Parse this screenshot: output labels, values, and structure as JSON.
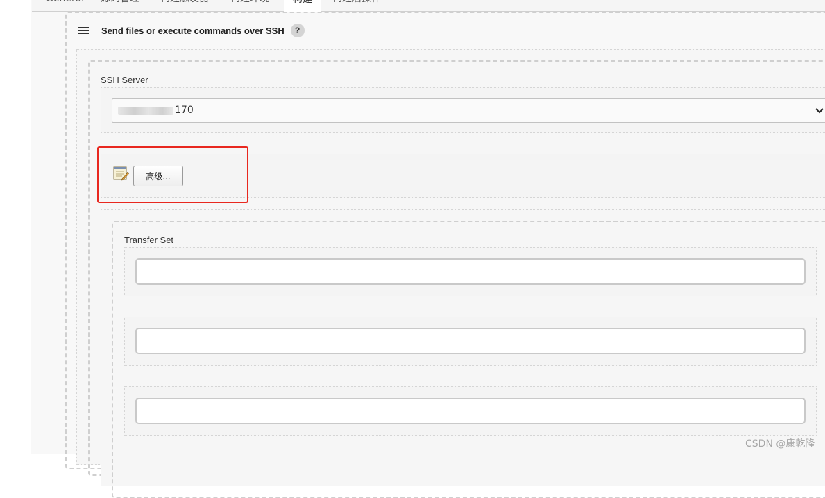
{
  "tabs": [
    {
      "label": "General",
      "active": false
    },
    {
      "label": "源码管理",
      "active": false
    },
    {
      "label": "构建触发器",
      "active": false
    },
    {
      "label": "构建环境",
      "active": false
    },
    {
      "label": "构建",
      "active": true
    },
    {
      "label": "构建后操作",
      "active": false
    }
  ],
  "section": {
    "title": "Send files or execute commands over SSH",
    "help": "?"
  },
  "ssh_server": {
    "label": "SSH Server",
    "selected_value": "170"
  },
  "advanced": {
    "button_label": "高级..."
  },
  "transfer_set": {
    "label": "Transfer Set",
    "fields": [
      {
        "value": ""
      },
      {
        "value": ""
      },
      {
        "value": ""
      }
    ]
  },
  "watermark": "CSDN @康乾隆",
  "colors": {
    "highlight_border": "#e8281f",
    "dashed_border": "#cfcfcf",
    "panel_bg": "#f6f6f6"
  }
}
